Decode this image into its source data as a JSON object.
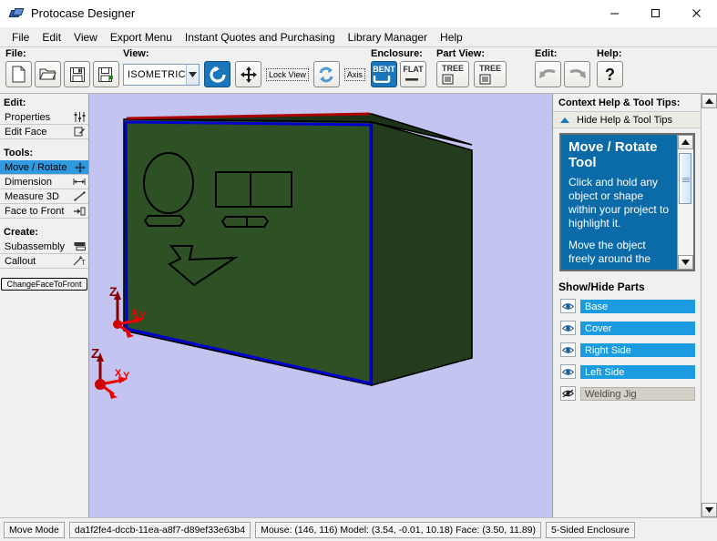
{
  "window": {
    "title": "Protocase Designer",
    "minimize_label": "Minimize",
    "maximize_label": "Maximize",
    "close_label": "Close"
  },
  "menubar": [
    {
      "label": "File"
    },
    {
      "label": "Edit"
    },
    {
      "label": "View"
    },
    {
      "label": "Export Menu"
    },
    {
      "label": "Instant Quotes and Purchasing"
    },
    {
      "label": "Library Manager"
    },
    {
      "label": "Help"
    }
  ],
  "toolbar": {
    "groups": [
      {
        "label": "File:"
      },
      {
        "label": "View:"
      },
      {
        "label": "Enclosure:"
      },
      {
        "label": "Part View:"
      },
      {
        "label": "Edit:"
      },
      {
        "label": "Help:"
      }
    ],
    "file": {
      "new_label": "New",
      "open_label": "Open",
      "save_label": "Save",
      "save_as_label": "Save As"
    },
    "view": {
      "orientation_value": "ISOMETRIC",
      "rotate_label": "Rotate",
      "pan_label": "Pan",
      "lock_view_label": "Lock View",
      "refresh_label": "Refresh",
      "axis_label": "Axis"
    },
    "enclosure": {
      "bent_label": "BENT",
      "flat_label": "FLAT"
    },
    "part_view": {
      "tree1_label": "TREE",
      "tree2_label": "TREE"
    },
    "edit": {
      "undo_label": "Undo",
      "redo_label": "Redo"
    },
    "help": {
      "help_label": "?"
    }
  },
  "sidebar": {
    "edit_header": "Edit:",
    "edit_items": [
      {
        "label": "Properties",
        "icon": "sliders-icon",
        "selected": false
      },
      {
        "label": "Edit Face",
        "icon": "edit-face-icon",
        "selected": false
      }
    ],
    "tools_header": "Tools:",
    "tools_items": [
      {
        "label": "Move / Rotate",
        "icon": "move-rotate-icon",
        "selected": true
      },
      {
        "label": "Dimension",
        "icon": "dimension-icon",
        "selected": false
      },
      {
        "label": "Measure 3D",
        "icon": "measure-icon",
        "selected": false
      },
      {
        "label": "Face to Front",
        "icon": "face-to-front-icon",
        "selected": false
      }
    ],
    "create_header": "Create:",
    "create_items": [
      {
        "label": "Subassembly",
        "icon": "subassembly-icon",
        "selected": false
      },
      {
        "label": "Callout",
        "icon": "callout-icon",
        "selected": false
      }
    ],
    "change_face_button": "ChangeFaceToFront"
  },
  "help_panel": {
    "title": "Context Help & Tool Tips:",
    "hide_label": "Hide Help & Tool Tips",
    "tip_title": "Move / Rotate Tool",
    "tip_paragraph_1": "Click and hold any object or shape within your project to highlight it.",
    "tip_paragraph_2": "Move the object freely around the"
  },
  "show_hide_parts": {
    "title": "Show/Hide Parts",
    "items": [
      {
        "label": "Base",
        "visible": true
      },
      {
        "label": "Cover",
        "visible": true
      },
      {
        "label": "Right Side",
        "visible": true
      },
      {
        "label": "Left Side",
        "visible": true
      },
      {
        "label": "Welding Jig",
        "visible": false
      }
    ]
  },
  "statusbar": {
    "mode": "Move Mode",
    "document_id": "da1f2fe4-dccb-11ea-a8f7-d89ef33e63b4",
    "coordinates": "Mouse: (146, 116) Model: (3.54, -0.01, 10.18) Face: (3.50, 11.89)",
    "enclosure_type": "5-Sided Enclosure"
  },
  "viewport": {
    "background_color": "#c4c4f0",
    "front_face_color": "#2d5024",
    "side_face_color": "#233d1c",
    "top_face_color": "#2a4a21",
    "highlight_edge_color": "#0000cc",
    "top_edge_color": "#aa0000",
    "axis_origin_label_z": "Z",
    "axis_origin_label_x": "X",
    "axis_origin_label_y": "Y"
  }
}
